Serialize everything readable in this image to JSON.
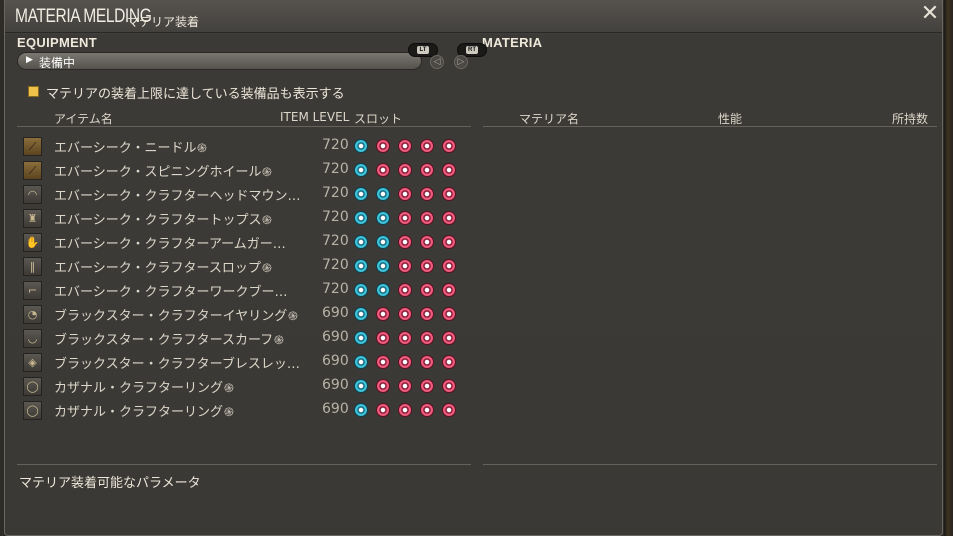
{
  "window": {
    "title_en": "MATERIA MELDING",
    "title_jp": "マテリア装着",
    "close_icon": "close-x-icon"
  },
  "equipment": {
    "heading": "EQUIPMENT",
    "filter_selected": "装備中",
    "lt_label": "LT",
    "rt_label": "RT",
    "checkbox_label": "マテリアの装着上限に達している装備品も表示する",
    "checkbox_checked": true,
    "columns": {
      "name": "アイテム名",
      "item_level": "ITEM LEVEL",
      "slots": "スロット"
    },
    "items": [
      {
        "icon": "needle-icon",
        "name": "エバーシーク・ニードル",
        "hq": true,
        "ilvl": "720",
        "slots": [
          "blue",
          "pink",
          "pink",
          "pink",
          "pink"
        ],
        "highlight": true
      },
      {
        "icon": "spinning-wheel-icon",
        "name": "エバーシーク・スピニングホイール",
        "hq": true,
        "ilvl": "720",
        "slots": [
          "blue",
          "pink",
          "pink",
          "pink",
          "pink"
        ],
        "highlight": true
      },
      {
        "icon": "headgear-icon",
        "name": "エバーシーク・クラフターヘッドマウン…",
        "hq": false,
        "ilvl": "720",
        "slots": [
          "blue",
          "blue",
          "pink",
          "pink",
          "pink"
        ]
      },
      {
        "icon": "body-armor-icon",
        "name": "エバーシーク・クラフタートップス",
        "hq": true,
        "ilvl": "720",
        "slots": [
          "blue",
          "blue",
          "pink",
          "pink",
          "pink"
        ]
      },
      {
        "icon": "gloves-icon",
        "name": "エバーシーク・クラフターアームガー…",
        "hq": false,
        "ilvl": "720",
        "slots": [
          "blue",
          "blue",
          "pink",
          "pink",
          "pink"
        ]
      },
      {
        "icon": "legs-icon",
        "name": "エバーシーク・クラフタースロップ",
        "hq": true,
        "ilvl": "720",
        "slots": [
          "blue",
          "blue",
          "pink",
          "pink",
          "pink"
        ]
      },
      {
        "icon": "boots-icon",
        "name": "エバーシーク・クラフターワークブー…",
        "hq": false,
        "ilvl": "720",
        "slots": [
          "blue",
          "blue",
          "pink",
          "pink",
          "pink"
        ]
      },
      {
        "icon": "earring-icon",
        "name": "ブラックスター・クラフターイヤリング",
        "hq": true,
        "ilvl": "690",
        "slots": [
          "blue",
          "pink",
          "pink",
          "pink",
          "pink"
        ]
      },
      {
        "icon": "necklace-icon",
        "name": "ブラックスター・クラフタースカーフ",
        "hq": true,
        "ilvl": "690",
        "slots": [
          "blue",
          "pink",
          "pink",
          "pink",
          "pink"
        ]
      },
      {
        "icon": "bracelet-icon",
        "name": "ブラックスター・クラフターブレスレッ…",
        "hq": false,
        "ilvl": "690",
        "slots": [
          "blue",
          "pink",
          "pink",
          "pink",
          "pink"
        ]
      },
      {
        "icon": "ring-icon",
        "name": "カザナル・クラフターリング",
        "hq": true,
        "ilvl": "690",
        "slots": [
          "blue",
          "pink",
          "pink",
          "pink",
          "pink"
        ]
      },
      {
        "icon": "ring-icon",
        "name": "カザナル・クラフターリング",
        "hq": true,
        "ilvl": "690",
        "slots": [
          "blue",
          "pink",
          "pink",
          "pink",
          "pink"
        ]
      }
    ],
    "hq_mark": "֍"
  },
  "materia": {
    "heading": "MATERIA",
    "columns": {
      "name": "マテリア名",
      "performance": "性能",
      "owned": "所持数"
    }
  },
  "footer": {
    "params_label": "マテリア装着可能なパラメータ"
  },
  "colors": {
    "slot_blue": "#3ec3d8",
    "slot_pink": "#ee5b7c",
    "checkbox": "#f0c14a"
  }
}
